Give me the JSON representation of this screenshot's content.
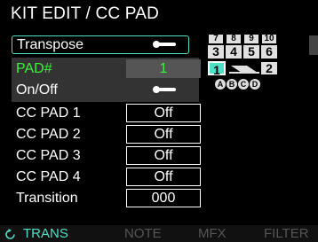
{
  "title": "KIT EDIT / CC PAD",
  "params": {
    "transpose": {
      "label": "Transpose"
    },
    "pad": {
      "label": "PAD#",
      "value": "1"
    },
    "onoff": {
      "label": "On/Off"
    },
    "cc1": {
      "label": "CC PAD 1",
      "value": "Off"
    },
    "cc2": {
      "label": "CC PAD 2",
      "value": "Off"
    },
    "cc3": {
      "label": "CC PAD 3",
      "value": "Off"
    },
    "cc4": {
      "label": "CC PAD 4",
      "value": "Off"
    },
    "transition": {
      "label": "Transition",
      "value": "000"
    }
  },
  "pad_grid": {
    "row1": [
      "7",
      "8",
      "9",
      "10"
    ],
    "row2": [
      "3",
      "4",
      "5",
      "6"
    ],
    "row3": [
      "1",
      "2"
    ],
    "circles": [
      "A",
      "B",
      "C",
      "D"
    ]
  },
  "tabs": [
    "TRANS",
    "NOTE",
    "MFX",
    "FILTER"
  ],
  "colors": {
    "accent": "#4ee0c6",
    "pad_green": "#3df03d",
    "background": "#000000"
  },
  "icons": {
    "tab_indicator": "refresh-icon",
    "toggle": "toggle-switch-icon"
  }
}
